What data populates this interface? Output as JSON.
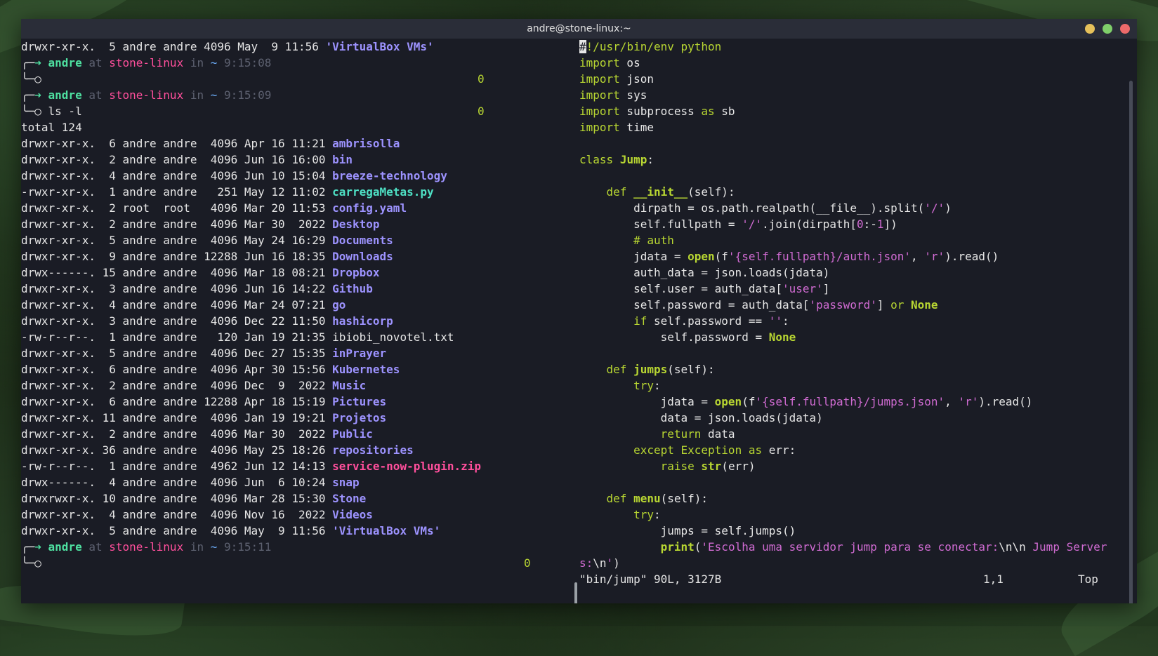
{
  "window": {
    "title": "andre@stone-linux:~",
    "buttons": {
      "minimize_color": "#e6c15a",
      "maximize_color": "#7fcf6a",
      "close_color": "#ed6a6a"
    }
  },
  "terminal": {
    "top_line": {
      "perm": "drwxr-xr-x.",
      "links": " 5",
      "owner": "andre",
      "group": "andre",
      "size": "4096",
      "date": "May  9 11:56",
      "name": "'VirtualBox VMs'"
    },
    "prompts": [
      {
        "arrow": "➜",
        "user": "andre",
        "at": "at",
        "host": "stone-linux",
        "in": "in",
        "dir": "~",
        "time": "9:15:08",
        "command": "",
        "status": "0"
      },
      {
        "arrow": "➜",
        "user": "andre",
        "at": "at",
        "host": "stone-linux",
        "in": "in",
        "dir": "~",
        "time": "9:15:09",
        "command": "ls -l",
        "status": "0"
      },
      {
        "arrow": "➜",
        "user": "andre",
        "at": "at",
        "host": "stone-linux",
        "in": "in",
        "dir": "~",
        "time": "9:15:11",
        "command": "",
        "status": "0"
      }
    ],
    "total": "total 124",
    "listing": [
      {
        "perm": "drwxr-xr-x.",
        "links": " 6",
        "owner": "andre",
        "group": "andre",
        "size": " 4096",
        "date": "Apr 16 11:21",
        "name": "ambrisolla",
        "kind": "dir"
      },
      {
        "perm": "drwxr-xr-x.",
        "links": " 2",
        "owner": "andre",
        "group": "andre",
        "size": " 4096",
        "date": "Jun 16 16:00",
        "name": "bin",
        "kind": "dir"
      },
      {
        "perm": "drwxr-xr-x.",
        "links": " 4",
        "owner": "andre",
        "group": "andre",
        "size": " 4096",
        "date": "Jun 10 15:04",
        "name": "breeze-technology",
        "kind": "dir"
      },
      {
        "perm": "-rwxr-xr-x.",
        "links": " 1",
        "owner": "andre",
        "group": "andre",
        "size": "  251",
        "date": "May 12 11:02",
        "name": "carregaMetas.py",
        "kind": "exe"
      },
      {
        "perm": "drwxr-xr-x.",
        "links": " 2",
        "owner": "root ",
        "group": "root ",
        "size": " 4096",
        "date": "Mar 20 11:53",
        "name": "config.yaml",
        "kind": "dir"
      },
      {
        "perm": "drwxr-xr-x.",
        "links": " 2",
        "owner": "andre",
        "group": "andre",
        "size": " 4096",
        "date": "Mar 30  2022",
        "name": "Desktop",
        "kind": "dir"
      },
      {
        "perm": "drwxr-xr-x.",
        "links": " 5",
        "owner": "andre",
        "group": "andre",
        "size": " 4096",
        "date": "May 24 16:29",
        "name": "Documents",
        "kind": "dir"
      },
      {
        "perm": "drwxr-xr-x.",
        "links": " 9",
        "owner": "andre",
        "group": "andre",
        "size": "12288",
        "date": "Jun 16 18:35",
        "name": "Downloads",
        "kind": "dir"
      },
      {
        "perm": "drwx------.",
        "links": "15",
        "owner": "andre",
        "group": "andre",
        "size": " 4096",
        "date": "Mar 18 08:21",
        "name": "Dropbox",
        "kind": "dir"
      },
      {
        "perm": "drwxr-xr-x.",
        "links": " 3",
        "owner": "andre",
        "group": "andre",
        "size": " 4096",
        "date": "Jun 16 14:22",
        "name": "Github",
        "kind": "dir"
      },
      {
        "perm": "drwxr-xr-x.",
        "links": " 4",
        "owner": "andre",
        "group": "andre",
        "size": " 4096",
        "date": "Mar 24 07:21",
        "name": "go",
        "kind": "dir"
      },
      {
        "perm": "drwxr-xr-x.",
        "links": " 3",
        "owner": "andre",
        "group": "andre",
        "size": " 4096",
        "date": "Dec 22 11:50",
        "name": "hashicorp",
        "kind": "dir"
      },
      {
        "perm": "-rw-r--r--.",
        "links": " 1",
        "owner": "andre",
        "group": "andre",
        "size": "  120",
        "date": "Jan 19 21:35",
        "name": "ibiobi_novotel.txt",
        "kind": "file"
      },
      {
        "perm": "drwxr-xr-x.",
        "links": " 5",
        "owner": "andre",
        "group": "andre",
        "size": " 4096",
        "date": "Dec 27 15:35",
        "name": "inPrayer",
        "kind": "dir"
      },
      {
        "perm": "drwxr-xr-x.",
        "links": " 6",
        "owner": "andre",
        "group": "andre",
        "size": " 4096",
        "date": "Apr 30 15:56",
        "name": "Kubernetes",
        "kind": "dir"
      },
      {
        "perm": "drwxr-xr-x.",
        "links": " 2",
        "owner": "andre",
        "group": "andre",
        "size": " 4096",
        "date": "Dec  9  2022",
        "name": "Music",
        "kind": "dir"
      },
      {
        "perm": "drwxr-xr-x.",
        "links": " 6",
        "owner": "andre",
        "group": "andre",
        "size": "12288",
        "date": "Apr 18 15:19",
        "name": "Pictures",
        "kind": "dir"
      },
      {
        "perm": "drwxr-xr-x.",
        "links": "11",
        "owner": "andre",
        "group": "andre",
        "size": " 4096",
        "date": "Jan 19 19:21",
        "name": "Projetos",
        "kind": "dir"
      },
      {
        "perm": "drwxr-xr-x.",
        "links": " 2",
        "owner": "andre",
        "group": "andre",
        "size": " 4096",
        "date": "Mar 30  2022",
        "name": "Public",
        "kind": "dir"
      },
      {
        "perm": "drwxr-xr-x.",
        "links": "36",
        "owner": "andre",
        "group": "andre",
        "size": " 4096",
        "date": "May 25 18:26",
        "name": "repositories",
        "kind": "dir"
      },
      {
        "perm": "-rw-r--r--.",
        "links": " 1",
        "owner": "andre",
        "group": "andre",
        "size": " 4962",
        "date": "Jun 12 14:13",
        "name": "service-now-plugin.zip",
        "kind": "zip"
      },
      {
        "perm": "drwx------.",
        "links": " 4",
        "owner": "andre",
        "group": "andre",
        "size": " 4096",
        "date": "Jun  6 10:24",
        "name": "snap",
        "kind": "dir"
      },
      {
        "perm": "drwxrwxr-x.",
        "links": "10",
        "owner": "andre",
        "group": "andre",
        "size": " 4096",
        "date": "Mar 28 15:30",
        "name": "Stone",
        "kind": "dir"
      },
      {
        "perm": "drwxr-xr-x.",
        "links": " 4",
        "owner": "andre",
        "group": "andre",
        "size": " 4096",
        "date": "Nov 16  2022",
        "name": "Videos",
        "kind": "dir"
      },
      {
        "perm": "drwxr-xr-x.",
        "links": " 5",
        "owner": "andre",
        "group": "andre",
        "size": " 4096",
        "date": "May  9 11:56",
        "name": "'VirtualBox VMs'",
        "kind": "quoted"
      }
    ]
  },
  "editor": {
    "lines": [
      [
        [
          "cursor",
          "#"
        ],
        [
          "cmt",
          "!/usr/bin/env python"
        ]
      ],
      [
        [
          "kw",
          "import"
        ],
        [
          "sp",
          " os"
        ]
      ],
      [
        [
          "kw",
          "import"
        ],
        [
          "sp",
          " json"
        ]
      ],
      [
        [
          "kw",
          "import"
        ],
        [
          "sp",
          " sys"
        ]
      ],
      [
        [
          "kw",
          "import"
        ],
        [
          "sp",
          " subprocess "
        ],
        [
          "kw",
          "as"
        ],
        [
          "sp",
          " sb"
        ]
      ],
      [
        [
          "kw",
          "import"
        ],
        [
          "sp",
          " time"
        ]
      ],
      [],
      [
        [
          "kw",
          "class"
        ],
        [
          "sp",
          " "
        ],
        [
          "cls",
          "Jump"
        ],
        [
          "sp",
          ":"
        ]
      ],
      [],
      [
        [
          "sp",
          "    "
        ],
        [
          "kw",
          "def"
        ],
        [
          "sp",
          " "
        ],
        [
          "fn",
          "__init__"
        ],
        [
          "sp",
          "(self):"
        ]
      ],
      [
        [
          "sp",
          "        dirpath = os.path.realpath(__file__).split("
        ],
        [
          "str",
          "'/'"
        ],
        [
          "sp",
          ")"
        ]
      ],
      [
        [
          "sp",
          "        self.fullpath = "
        ],
        [
          "str",
          "'/'"
        ],
        [
          "sp",
          ".join(dirpath["
        ],
        [
          "num",
          "0"
        ],
        [
          "sp",
          ":-"
        ],
        [
          "num",
          "1"
        ],
        [
          "sp",
          "])"
        ]
      ],
      [
        [
          "sp",
          "        "
        ],
        [
          "cmt",
          "# auth"
        ]
      ],
      [
        [
          "sp",
          "        jdata = "
        ],
        [
          "bi",
          "open"
        ],
        [
          "sp",
          "(f"
        ],
        [
          "str",
          "'{self.fullpath}/auth.json'"
        ],
        [
          "sp",
          ", "
        ],
        [
          "str",
          "'r'"
        ],
        [
          "sp",
          ").read()"
        ]
      ],
      [
        [
          "sp",
          "        auth_data = json.loads(jdata)"
        ]
      ],
      [
        [
          "sp",
          "        self.user = auth_data["
        ],
        [
          "str",
          "'user'"
        ],
        [
          "sp",
          "]"
        ]
      ],
      [
        [
          "sp",
          "        self.password = auth_data["
        ],
        [
          "str",
          "'password'"
        ],
        [
          "sp",
          "] "
        ],
        [
          "kw",
          "or"
        ],
        [
          "sp",
          " "
        ],
        [
          "const",
          "None"
        ]
      ],
      [
        [
          "sp",
          "        "
        ],
        [
          "kw",
          "if"
        ],
        [
          "sp",
          " self.password == "
        ],
        [
          "str",
          "''"
        ],
        [
          "sp",
          ":"
        ]
      ],
      [
        [
          "sp",
          "            self.password = "
        ],
        [
          "const",
          "None"
        ]
      ],
      [],
      [
        [
          "sp",
          "    "
        ],
        [
          "kw",
          "def"
        ],
        [
          "sp",
          " "
        ],
        [
          "fn",
          "jumps"
        ],
        [
          "sp",
          "(self):"
        ]
      ],
      [
        [
          "sp",
          "        "
        ],
        [
          "kw",
          "try"
        ],
        [
          "sp",
          ":"
        ]
      ],
      [
        [
          "sp",
          "            jdata = "
        ],
        [
          "bi",
          "open"
        ],
        [
          "sp",
          "(f"
        ],
        [
          "str",
          "'{self.fullpath}/jumps.json'"
        ],
        [
          "sp",
          ", "
        ],
        [
          "str",
          "'r'"
        ],
        [
          "sp",
          ").read()"
        ]
      ],
      [
        [
          "sp",
          "            data = json.loads(jdata)"
        ]
      ],
      [
        [
          "sp",
          "            "
        ],
        [
          "kw",
          "return"
        ],
        [
          "sp",
          " data"
        ]
      ],
      [
        [
          "sp",
          "        "
        ],
        [
          "kw",
          "except"
        ],
        [
          "sp",
          " "
        ],
        [
          "kw",
          "Exception"
        ],
        [
          "sp",
          " "
        ],
        [
          "kw",
          "as"
        ],
        [
          "sp",
          " err:"
        ]
      ],
      [
        [
          "sp",
          "            "
        ],
        [
          "kw",
          "raise"
        ],
        [
          "sp",
          " "
        ],
        [
          "bi",
          "str"
        ],
        [
          "sp",
          "(err)"
        ]
      ],
      [],
      [
        [
          "sp",
          "    "
        ],
        [
          "kw",
          "def"
        ],
        [
          "sp",
          " "
        ],
        [
          "fn",
          "menu"
        ],
        [
          "sp",
          "(self):"
        ]
      ],
      [
        [
          "sp",
          "        "
        ],
        [
          "kw",
          "try"
        ],
        [
          "sp",
          ":"
        ]
      ],
      [
        [
          "sp",
          "            jumps = self.jumps()"
        ]
      ],
      [
        [
          "sp",
          "            "
        ],
        [
          "bi",
          "print"
        ],
        [
          "sp",
          "("
        ],
        [
          "str",
          "'Escolha uma servidor jump para se conectar:"
        ],
        [
          "sp",
          "\\n\\n"
        ],
        [
          "str",
          " Jump Server"
        ]
      ],
      [
        [
          "str",
          "s:"
        ],
        [
          "sp",
          "\\n"
        ],
        [
          "str",
          "'"
        ],
        [
          "sp",
          ")"
        ]
      ]
    ],
    "statusline": {
      "file": "\"bin/jump\" 90L, 3127B",
      "position": "1,1",
      "scroll": "Top"
    }
  }
}
